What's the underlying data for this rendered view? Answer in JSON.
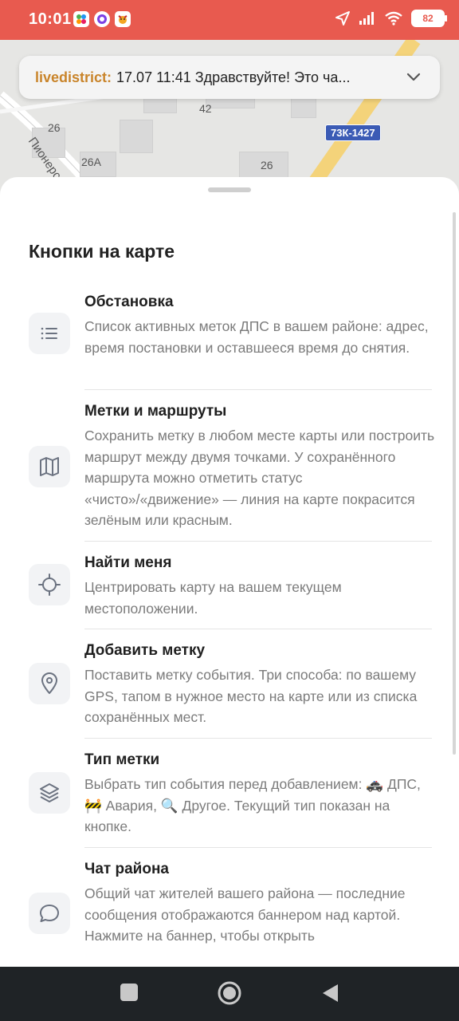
{
  "status_bar": {
    "time": "10:01",
    "battery": "82"
  },
  "map": {
    "labels": [
      "42",
      "26",
      "26А",
      "26"
    ],
    "street": "Пионерс",
    "route_badge": "73К-1427"
  },
  "chat_banner": {
    "author": "livedistrict:",
    "text": "17.07 11:41 Здравствуйте! Это ча..."
  },
  "sheet": {
    "title": "Кнопки на карте",
    "items": [
      {
        "title": "Обстановка",
        "desc": "Список активных меток ДПС в вашем районе: адрес, время постановки и оставшееся время до снятия.",
        "icon": "list-icon"
      },
      {
        "title": "Метки и маршруты",
        "desc": "Сохранить метку в любом месте карты или построить маршрут между двумя точками. У сохранённого маршрута можно отметить статус «чисто»/«движение» — линия на карте покрасится зелёным или красным.",
        "icon": "map-icon"
      },
      {
        "title": "Найти меня",
        "desc": "Центрировать карту на вашем текущем местоположении.",
        "icon": "crosshair-icon"
      },
      {
        "title": "Добавить метку",
        "desc": "Поставить метку события. Три способа: по вашему GPS, тапом в нужное место на карте или из списка сохранённых мест.",
        "icon": "pin-icon"
      },
      {
        "title": "Тип метки",
        "desc": "Выбрать тип события перед добавлением: 🚓 ДПС, 🚧 Авария, 🔍 Другое. Текущий тип показан на кнопке.",
        "icon": "layers-icon"
      },
      {
        "title": "Чат района",
        "desc": "Общий чат жителей вашего района — последние сообщения отображаются баннером над картой. Нажмите на баннер, чтобы открыть",
        "icon": "chat-bubble-icon"
      }
    ]
  },
  "colors": {
    "status_bar": "#e85a4f",
    "author": "#c9842a",
    "nav_bar": "#1f2326"
  }
}
